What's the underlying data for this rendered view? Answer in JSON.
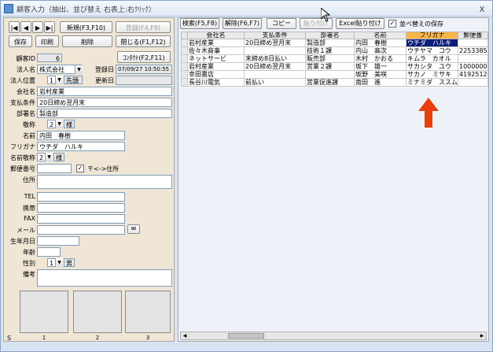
{
  "window": {
    "title": "顧客入力（抽出、並び替え 右表上:右ｸﾘｯｸ）",
    "close": "x"
  },
  "nav": {
    "first": "|◀",
    "prev": "◀",
    "next": "▶",
    "last": "▶|"
  },
  "buttons": {
    "new": "新規(F3,F10)",
    "register": "登録(F4,F9)",
    "save": "保存",
    "print": "印刷",
    "delete": "削除",
    "close": "閉じる(F1,F12)",
    "contact": "ｺﾝﾀｸﾄ(F2,F11)"
  },
  "form": {
    "customer_id_label": "顧客ID",
    "customer_id": "6",
    "corp_name_label": "法人名",
    "corp_name": "株式会社",
    "reg_date_label": "登録日",
    "reg_date": "07/09/27 10:50:55",
    "corp_pos_label": "法人位置",
    "corp_pos_num": "1",
    "corp_pos": "先頭",
    "update_date_label": "更新日",
    "update_date": "",
    "company_label": "会社名",
    "company": "岩村産業",
    "payment_label": "支払条件",
    "payment": "20日締め翌月末",
    "dept_label": "部署名",
    "dept": "製造部",
    "honorific_label": "敬称",
    "honorific_num": "2",
    "honorific": "様",
    "name_label": "名前",
    "name": "内田　春樹",
    "kana_label": "フリガナ",
    "kana": "ウチダ　ハルキ",
    "name_honorific_label": "名前敬称",
    "name_honorific_num": "2",
    "name_honorific": "様",
    "zip_label": "郵便番号",
    "zip": "",
    "zip_addr_check": "〒<->住所",
    "address_label": "住所",
    "address": "",
    "tel_label": "TEL",
    "tel": "",
    "mobile_label": "携帯",
    "mobile": "",
    "fax_label": "FAX",
    "fax": "",
    "mail_label": "メール",
    "mail": "",
    "birth_label": "生年月日",
    "birth": "",
    "age_label": "年齢",
    "age": "",
    "gender_label": "性別",
    "gender_num": "1",
    "gender": "男",
    "notes_label": "備考",
    "notes": ""
  },
  "photos": {
    "s_label": "S",
    "labels": [
      "1",
      "2",
      "3"
    ]
  },
  "toolbar": {
    "search": "検索(F5,F8)",
    "release": "解除(F6,F7)",
    "copy": "コピー",
    "paste": "貼り付け",
    "excel_paste": "Excel貼り付け",
    "save_sort": "並べ替えの保存"
  },
  "grid": {
    "headers": [
      "会社名",
      "支払条件",
      "部署名",
      "名前",
      "フリガナ",
      "郵便番"
    ],
    "rows": [
      [
        "岩村産業",
        "20日締め翌月末",
        "製造部",
        "内田　春樹",
        "ウチダ　ハルキ",
        ""
      ],
      [
        "佐々木商事",
        "",
        "技術１課",
        "内山　高次",
        "ウチヤマ　コウ",
        "2253385"
      ],
      [
        "ネットサービ",
        "末締め8日払い",
        "販売部",
        "木村　かおる",
        "キムラ　カオル",
        ""
      ],
      [
        "岩村産業",
        "20日締め翌月末",
        "営業２課",
        "坂下　雄一",
        "サカシタ　ユウ",
        "1000000"
      ],
      [
        "幸田書店",
        "",
        "",
        "坂野　美咲",
        "サカノ　ミサキ",
        "4192512"
      ],
      [
        "長谷川電気",
        "前払い",
        "営業促進課",
        "南田　進",
        "ミナミダ　ススム",
        ""
      ]
    ]
  },
  "colors": {
    "accent_header": "#f7b64a",
    "selection": "#0a1e7a",
    "arrow": "#e8400c"
  }
}
